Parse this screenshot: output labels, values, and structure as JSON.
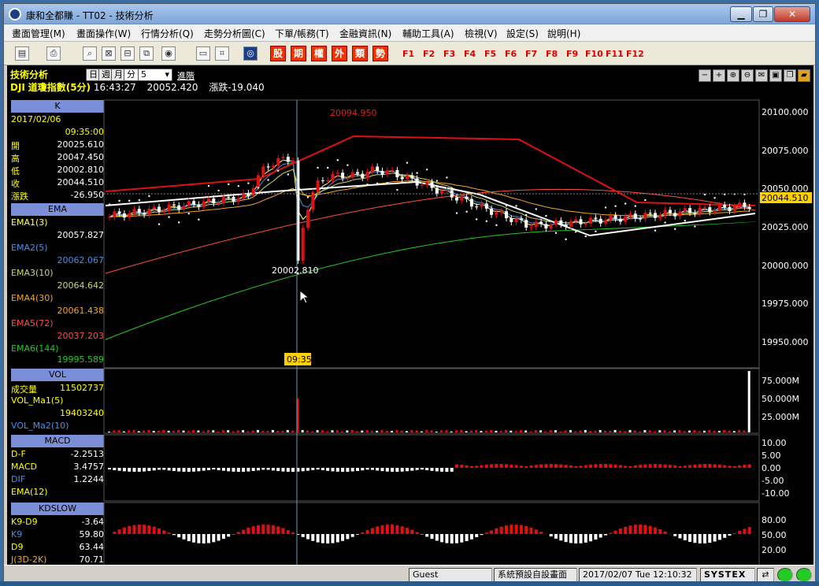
{
  "window": {
    "title": "康和全都賺 - TT02 - 技術分析"
  },
  "menu": [
    "畫面管理(M)",
    "畫面操作(W)",
    "行情分析(Q)",
    "走勢分析圖(C)",
    "下單/帳務(T)",
    "金融資訊(N)",
    "輔助工具(A)",
    "檢視(V)",
    "設定(S)",
    "說明(H)"
  ],
  "toolbar": {
    "red_buttons": [
      "股",
      "期",
      "權",
      "外",
      "類",
      "勢"
    ],
    "fkeys": [
      "F1",
      "F2",
      "F3",
      "F4",
      "F5",
      "F6",
      "F7",
      "F8",
      "F9",
      "F10",
      "F11",
      "F12"
    ]
  },
  "panel": {
    "title": "技術分析",
    "periods": [
      "日",
      "週",
      "月",
      "分"
    ],
    "interval": "5",
    "advanced": "進階"
  },
  "quote": {
    "symbol": "DJI",
    "name": "道瓊指數(5分)",
    "time": "16:43:27",
    "price": "20052.420",
    "change_label": "漲跌-19.040"
  },
  "k": {
    "header": "K",
    "date": "2017/02/06",
    "time": "09:35:00",
    "rows": [
      {
        "label": "開",
        "value": "20025.610"
      },
      {
        "label": "高",
        "value": "20047.450"
      },
      {
        "label": "低",
        "value": "20002.810"
      },
      {
        "label": "收",
        "value": "20044.510"
      },
      {
        "label": "漲跌",
        "value": "-26.950"
      }
    ]
  },
  "ema": {
    "header": "EMA",
    "items": [
      {
        "label": "EMA1(3)",
        "value": "20057.827",
        "color": "#ffff66"
      },
      {
        "label": "EMA2(5)",
        "value": "20062.067",
        "color": "#4a90e2"
      },
      {
        "label": "EMA3(10)",
        "value": "20064.642",
        "color": "#c8d86a"
      },
      {
        "label": "EMA4(30)",
        "value": "20061.438",
        "color": "#f5a623"
      },
      {
        "label": "EMA5(72)",
        "value": "20037.203",
        "color": "#ff5040"
      },
      {
        "label": "EMA6(144)",
        "value": "19995.589",
        "color": "#22cc22"
      }
    ]
  },
  "vol": {
    "header": "VOL",
    "items": [
      {
        "label": "成交量",
        "value": "11502737"
      },
      {
        "label": "VOL_Ma1(5)",
        "value": "19403240"
      },
      {
        "label": "VOL_Ma2(10)",
        "value": ""
      }
    ]
  },
  "macd": {
    "header": "MACD",
    "items": [
      {
        "label": "D-F",
        "value": "-2.2513"
      },
      {
        "label": "MACD",
        "value": "3.4757"
      },
      {
        "label": "DIF",
        "value": "1.2244"
      },
      {
        "label": "EMA(12)",
        "value": ""
      }
    ]
  },
  "kd": {
    "header": "KDSLOW",
    "items": [
      {
        "label": "K9-D9",
        "value": "-3.64"
      },
      {
        "label": "K9",
        "value": "59.80"
      },
      {
        "label": "D9",
        "value": "63.44"
      },
      {
        "label": "J(3D-2K)",
        "value": "70.71"
      }
    ]
  },
  "main_axis": {
    "ticks": [
      "20100.000",
      "20075.000",
      "20050.000",
      "20025.000",
      "20000.000",
      "19975.000",
      "19950.000"
    ],
    "current": "20044.510",
    "high_label": "20094.950",
    "low_label": "20002.810",
    "cursor_time": "09:35"
  },
  "vol_axis": {
    "ticks": [
      "75.000M",
      "50.000M",
      "25.000M"
    ]
  },
  "macd_axis": {
    "ticks": [
      "10.00",
      "5.00",
      "0.00",
      "-5.00",
      "-10.00"
    ]
  },
  "kd_axis": {
    "ticks": [
      "80.00",
      "50.00",
      "20.00"
    ]
  },
  "status": {
    "user": "Guest",
    "layout": "系統預設自設畫面",
    "datetime": "2017/02/07 Tue 12:10:32",
    "brand": "SYSTEX"
  }
}
